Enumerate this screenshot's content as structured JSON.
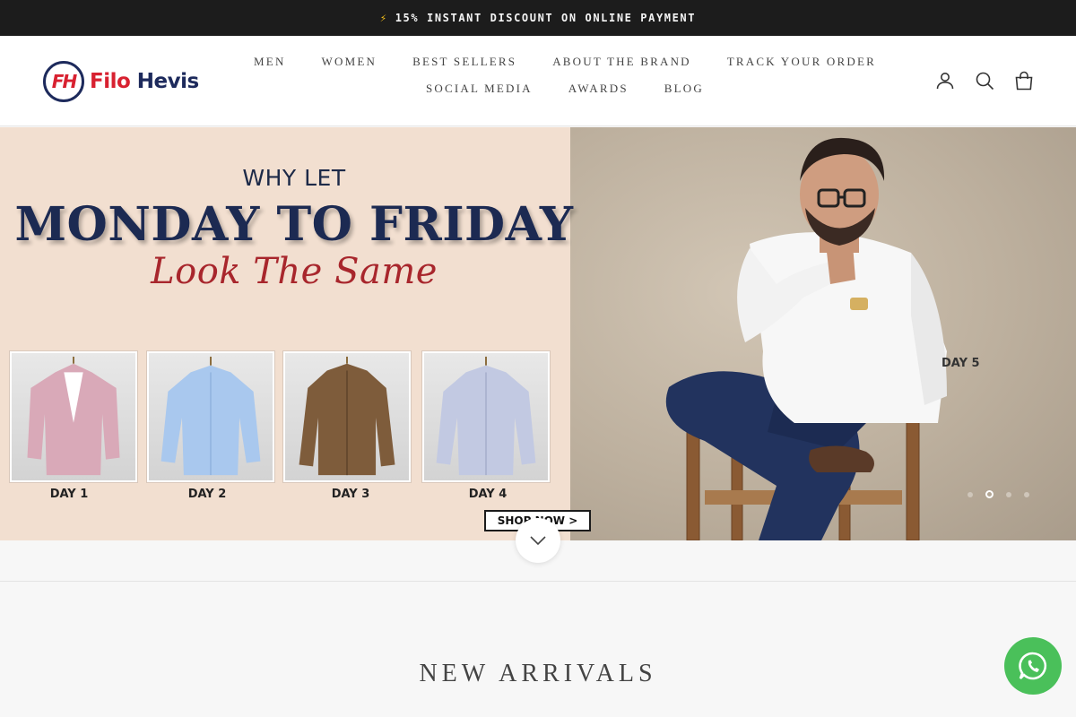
{
  "announcement": {
    "icon": "lightning-icon",
    "text": "15% INSTANT DISCOUNT ON ONLINE PAYMENT"
  },
  "logo": {
    "mark": "FH",
    "word1": "Filo",
    "word2": "Hevis"
  },
  "nav": {
    "row1": [
      "MEN",
      "WOMEN",
      "BEST SELLERS",
      "ABOUT THE BRAND",
      "TRACK YOUR ORDER"
    ],
    "row2": [
      "SOCIAL MEDIA",
      "AWARDS",
      "BLOG"
    ]
  },
  "header_icons": [
    "account-icon",
    "search-icon",
    "cart-icon"
  ],
  "hero": {
    "kicker": "WHY LET",
    "headline": "MONDAY TO FRIDAY",
    "script": "Look The Same",
    "days": [
      "DAY 1",
      "DAY 2",
      "DAY 3",
      "DAY 4"
    ],
    "day5": "DAY 5",
    "cta": "SHOP NOW >",
    "slides": 4,
    "active_slide": 2
  },
  "section": {
    "title": "NEW ARRIVALS"
  },
  "colors": {
    "brand_red": "#d82130",
    "brand_navy": "#1d2a5c",
    "whatsapp": "#4ac05a"
  }
}
